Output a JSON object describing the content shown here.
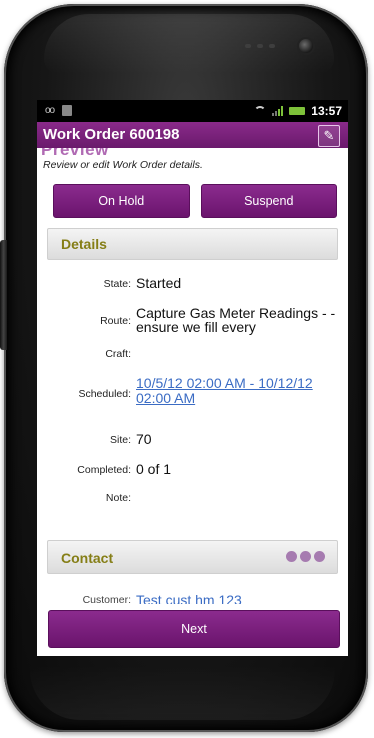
{
  "status_bar": {
    "time": "13:57",
    "voicemail_icon": "oo"
  },
  "app": {
    "title": "Work Order 600198",
    "action_icon": "edit-icon"
  },
  "page": {
    "heading": "Preview",
    "subtitle": "Review or edit Work Order details."
  },
  "actions": {
    "on_hold_label": "On Hold",
    "suspend_label": "Suspend",
    "next_label": "Next"
  },
  "details": {
    "section_title": "Details",
    "fields": [
      {
        "label": "State:",
        "value": "Started"
      },
      {
        "label": "Route:",
        "value": "Capture Gas Meter Readings - - ensure we fill every"
      },
      {
        "label": "Craft:",
        "value": ""
      },
      {
        "label": "Scheduled:",
        "value": "10/5/12 02:00 AM - 10/12/12 02:00 AM"
      },
      {
        "label": "Site:",
        "value": "70"
      },
      {
        "label": "Completed:",
        "value": "0 of 1"
      },
      {
        "label": "Note:",
        "value": ""
      }
    ]
  },
  "contact": {
    "section_title": "Contact",
    "customer_label": "Customer:",
    "customer_value": "Test cust hm 123"
  },
  "colors": {
    "accent_purple": "#7a1f7c",
    "section_title": "#857e16",
    "link": "#3b6cc4"
  }
}
